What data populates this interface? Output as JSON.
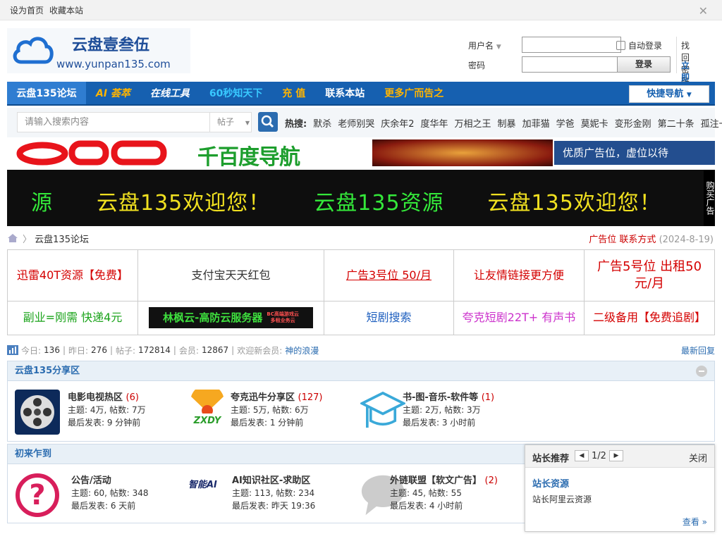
{
  "topbar": {
    "set_home": "设为首页",
    "favorite": "收藏本站",
    "close": "✕"
  },
  "logo": {
    "title": "云盘壹叁伍",
    "url": "www.yunpan135.com"
  },
  "login": {
    "username_label": "用户名",
    "password_label": "密码",
    "auto_login": "自动登录",
    "login_button": "登录",
    "find_password": "找回密码",
    "register": "立即注册"
  },
  "nav": {
    "items": [
      {
        "label": "云盘135论坛",
        "color": "#ffffff"
      },
      {
        "label": "AI 荟萃",
        "color": "#ffb400"
      },
      {
        "label": "在线工具",
        "color": "#ffffff"
      },
      {
        "label": "60秒知天下",
        "color": "#38c8ff"
      },
      {
        "label": "充 值",
        "color": "#ffb400"
      },
      {
        "label": "联系本站",
        "color": "#ffffff"
      },
      {
        "label": "更多广而告之",
        "color": "#ffb400"
      }
    ],
    "quick": "快捷导航"
  },
  "search": {
    "placeholder": "请输入搜索内容",
    "type": "帖子",
    "hot_label": "热搜:",
    "hot": [
      "默杀",
      "老师别哭",
      "庆余年2",
      "度华年",
      "万相之王",
      "制暴",
      "加菲猫",
      "学爸",
      "莫妮卡",
      "变形金刚",
      "第二十条",
      "孤注一掷"
    ]
  },
  "banners": {
    "b2": "千百度导航",
    "b4": "优质广告位，虚位以待"
  },
  "marquee": {
    "text": "源　　云盘135欢迎您！　　云盘135资源　　云盘135欢迎您！",
    "side": "购买广告"
  },
  "breadcrumb": {
    "path": "云盘135论坛",
    "ad": "广告位 联系方式",
    "date": "(2024-8-19)"
  },
  "ads": {
    "row1": [
      {
        "text": "迅雷40T资源【免费】",
        "color": "#d40000"
      },
      {
        "text": "支付宝天天红包",
        "color": "#333333"
      },
      {
        "text": "广告3号位 50/月",
        "color": "#d40000"
      },
      {
        "text": "让友情链接更方便",
        "color": "#d40000"
      },
      {
        "text": "广告5号位 出租50元/月",
        "color": "#d40000"
      }
    ],
    "row2": [
      {
        "text": "副业=刚需 快递4元",
        "color": "#1aa31a"
      },
      {
        "text": "林枫云-高防云服务器",
        "sub1": "BC高端游戏云",
        "sub2": "多租业务云",
        "color": "#3ee03e"
      },
      {
        "text": "短剧搜索",
        "color": "#1e5fbf"
      },
      {
        "text": "夸克短剧22T+ 有声书",
        "color": "#cc33cc"
      },
      {
        "text": "二级备用【免费追剧】",
        "color": "#d40000"
      }
    ]
  },
  "stats": {
    "today_label": "今日:",
    "today": "136",
    "yesterday_label": "昨日:",
    "yesterday": "276",
    "posts_label": "帖子:",
    "posts": "172814",
    "members_label": "会员:",
    "members": "12867",
    "welcome": "欢迎新会员:",
    "newest": "神的浪漫",
    "latest": "最新回复"
  },
  "section1": {
    "title": "云盘135分享区",
    "forums": [
      {
        "name": "电影电视热区",
        "count": "(6)",
        "topics": "主题: 4万, 帖数: 7万",
        "last": "最后发表: 9 分钟前"
      },
      {
        "name": "夸克迅牛分享区",
        "count": "(127)",
        "topics": "主题: 5万, 帖数: 6万",
        "last": "最后发表: 1 分钟前",
        "logo": "ZXDY"
      },
      {
        "name": "书-图-音乐-软件等",
        "count": "(1)",
        "topics": "主题: 2万, 帖数: 3万",
        "last": "最后发表: 3 小时前"
      }
    ]
  },
  "section2": {
    "title": "初来乍到",
    "forums": [
      {
        "name": "公告/活动",
        "count": "",
        "topics": "主题: 60, 帖数: 348",
        "last": "最后发表: 6 天前"
      },
      {
        "name": "AI知识社区-求助区",
        "count": "",
        "topics": "主题: 113, 帖数: 234",
        "last": "最后发表: 昨天 19:36",
        "logo": "智能AI"
      },
      {
        "name": "外链联盟【软文广告】",
        "count": "(2)",
        "topics": "主题: 45, 帖数: 55",
        "last": "最后发表: 4 小时前"
      }
    ]
  },
  "popup": {
    "title": "站长推荐",
    "page": "1/2",
    "close": "关闭",
    "item_title": "站长资源",
    "item_desc": "站长阿里云资源",
    "more": "查看 »"
  }
}
